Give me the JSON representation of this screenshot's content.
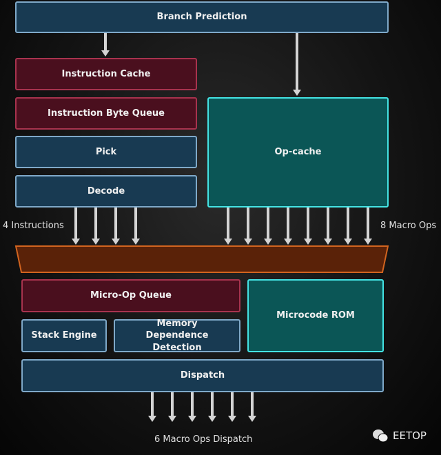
{
  "blocks": {
    "branch_prediction": "Branch Prediction",
    "instruction_cache": "Instruction Cache",
    "instruction_byte_queue": "Instruction Byte Queue",
    "pick": "Pick",
    "decode": "Decode",
    "op_cache": "Op-cache",
    "micro_op_queue": "Micro-Op Queue",
    "microcode_rom": "Microcode ROM",
    "stack_engine": "Stack Engine",
    "memory_dependence_detection": "Memory Dependence Detection",
    "dispatch": "Dispatch"
  },
  "labels": {
    "decode_width": "4 Instructions",
    "opcache_width": "8 Macro Ops",
    "dispatch_width": "6 Macro Ops Dispatch"
  },
  "watermark": "EETOP",
  "colors": {
    "blue_block": "#183a52",
    "red_block": "#4a0f1e",
    "teal_block": "#0b5656",
    "mux": "#5a2208"
  }
}
